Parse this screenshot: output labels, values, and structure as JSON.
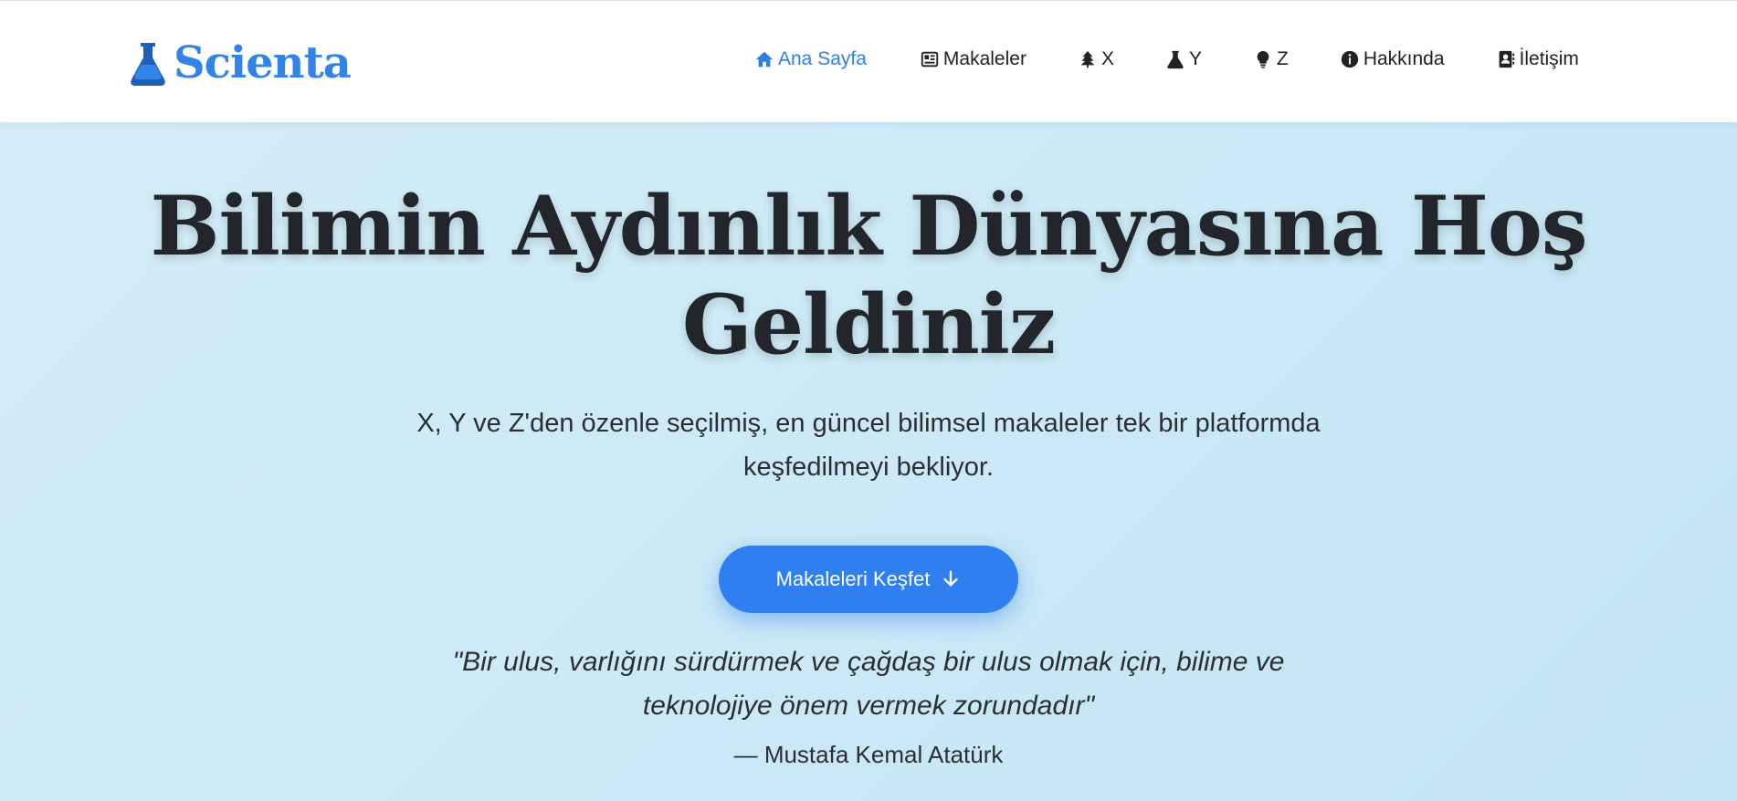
{
  "header": {
    "brand": "Scienta",
    "nav": [
      {
        "label": "Ana Sayfa",
        "icon": "home-icon",
        "active": true
      },
      {
        "label": "Makaleler",
        "icon": "newspaper-icon",
        "active": false
      },
      {
        "label": "X",
        "icon": "tree-icon",
        "active": false
      },
      {
        "label": "Y",
        "icon": "flask-icon",
        "active": false
      },
      {
        "label": "Z",
        "icon": "lightbulb-icon",
        "active": false
      },
      {
        "label": "Hakkında",
        "icon": "info-icon",
        "active": false
      },
      {
        "label": "İletişim",
        "icon": "contact-card-icon",
        "active": false
      }
    ]
  },
  "hero": {
    "title": "Bilimin Aydınlık Dünyasına Hoş Geldiniz",
    "subtitle": "X, Y ve Z'den özenle seçilmiş, en güncel bilimsel makaleler tek bir platformda keşfedilmeyi bekliyor.",
    "cta_label": "Makaleleri Keşfet",
    "quote": "\"Bir ulus, varlığını sürdürmek ve çağdaş bir ulus olmak için, bilime ve teknolojiye önem vermek zorundadır\"",
    "author": "— Mustafa Kemal Atatürk"
  },
  "colors": {
    "accent": "#2f7ff0",
    "brand": "#3285e6",
    "text": "#22262b"
  }
}
